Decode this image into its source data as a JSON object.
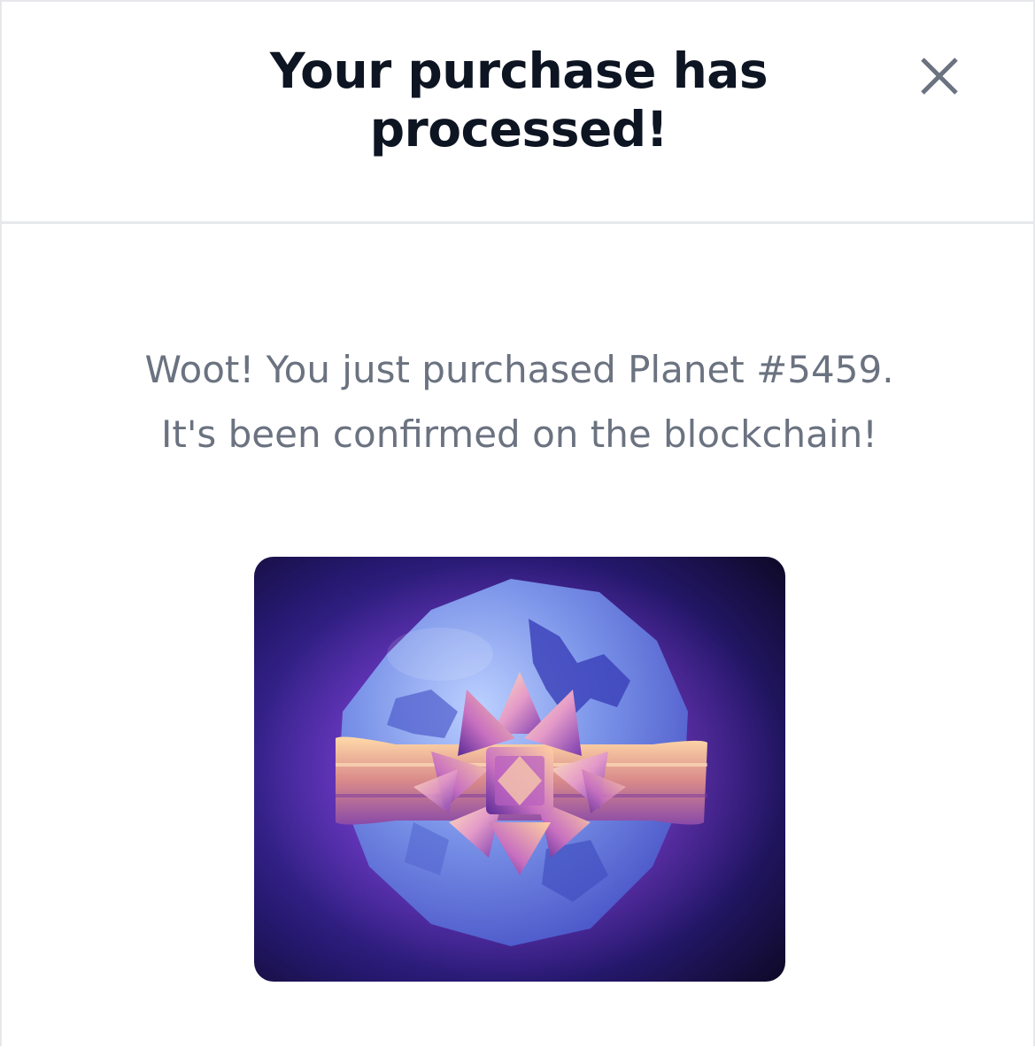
{
  "modal": {
    "title": "Your purchase has processed!",
    "close_icon": "close-icon"
  },
  "body": {
    "message_line1": "Woot! You just purchased Planet #5459.",
    "message_line2": "It's been confirmed on the blockchain!",
    "image_icon": "gift-wrapped-planet-image"
  },
  "colors": {
    "title": "#0d1422",
    "message": "#6b7280",
    "divider": "#e6e8ec",
    "close_icon": "#6b7280"
  }
}
